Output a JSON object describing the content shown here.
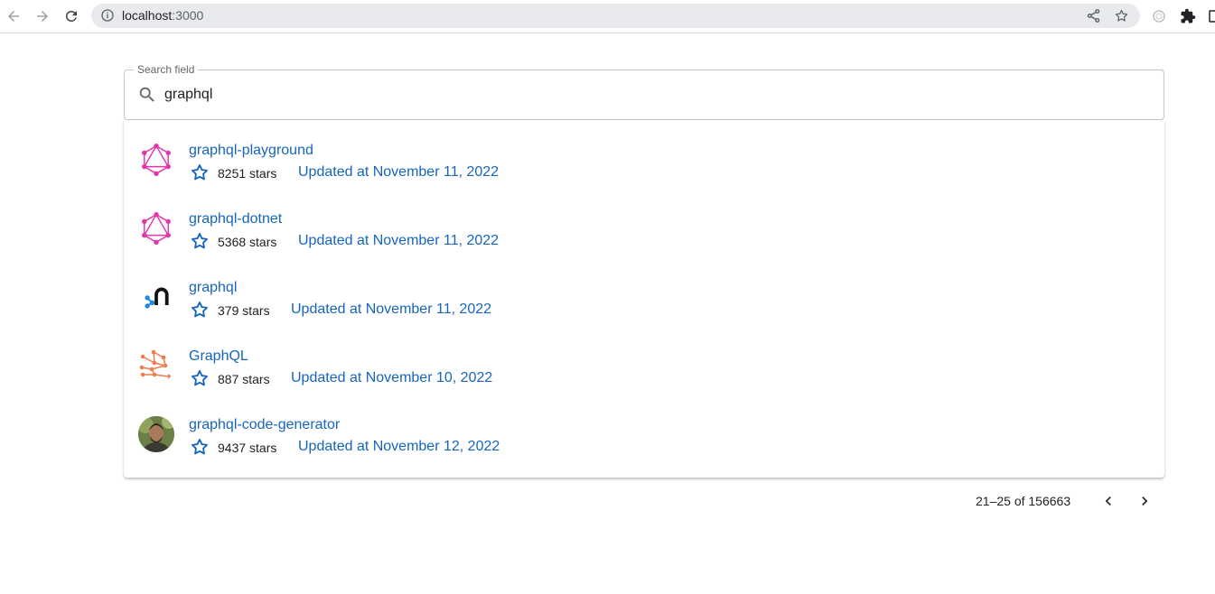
{
  "browser": {
    "url_host": "localhost",
    "url_port": ":3000"
  },
  "search": {
    "legend": "Search field",
    "value": "graphql"
  },
  "results": [
    {
      "name": "graphql-playground",
      "stars": "8251 stars",
      "updated": "Updated at November 11, 2022",
      "avatar": "graphql-logo-icon"
    },
    {
      "name": "graphql-dotnet",
      "stars": "5368 stars",
      "updated": "Updated at November 11, 2022",
      "avatar": "graphql-logo-icon"
    },
    {
      "name": "graphql",
      "stars": "379 stars",
      "updated": "Updated at November 11, 2022",
      "avatar": "nestjs-graphql-logo-icon"
    },
    {
      "name": "GraphQL",
      "stars": "887 stars",
      "updated": "Updated at November 10, 2022",
      "avatar": "network-graph-logo-icon"
    },
    {
      "name": "graphql-code-generator",
      "stars": "9437 stars",
      "updated": "Updated at November 12, 2022",
      "avatar": "user-avatar-photo"
    }
  ],
  "pagination": {
    "range_text": "21–25 of 156663"
  },
  "colors": {
    "link": "#1565c0",
    "graphql_pink": "#e535ab",
    "star_blue": "#1565c0"
  }
}
